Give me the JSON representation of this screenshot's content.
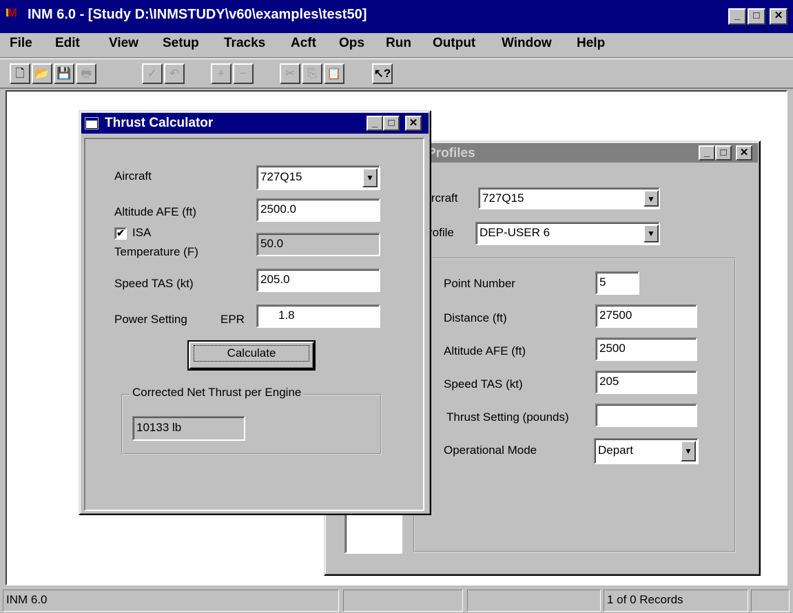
{
  "app": {
    "title": "INM 6.0 - [Study D:\\INMSTUDY\\v60\\examples\\test50]",
    "icon_text": "I",
    "icon_text_sub": "M",
    "caption_buttons": {
      "minimize": "_",
      "maximize": "□",
      "close": "✕"
    }
  },
  "menu": {
    "items": [
      "File",
      "Edit",
      "View",
      "Setup",
      "Tracks",
      "Acft",
      "Ops",
      "Run",
      "Output",
      "Window",
      "Help"
    ]
  },
  "toolbar": {
    "buttons": [
      {
        "name": "new-icon",
        "glyph": "🗋"
      },
      {
        "name": "open-icon",
        "glyph": "📂"
      },
      {
        "name": "save-icon",
        "glyph": "💾"
      },
      {
        "name": "print-icon",
        "glyph": "🖶"
      },
      {
        "name": "commit-icon",
        "glyph": "✓"
      },
      {
        "name": "undo-icon",
        "glyph": "↶"
      },
      {
        "name": "add-icon",
        "glyph": "+"
      },
      {
        "name": "remove-icon",
        "glyph": "−"
      },
      {
        "name": "cut-icon",
        "glyph": "✂"
      },
      {
        "name": "copy-icon",
        "glyph": "⎘"
      },
      {
        "name": "paste-icon",
        "glyph": "📋"
      },
      {
        "name": "context-help-icon",
        "glyph": "↖?"
      }
    ]
  },
  "thrust_calc": {
    "title": "Thrust Calculator",
    "aircraft_label": "Aircraft",
    "aircraft_value": "727Q15",
    "altitude_label": "Altitude AFE (ft)",
    "altitude_value": "2500.0",
    "isa_label": "ISA",
    "isa_checked": "✔",
    "temperature_label": "Temperature (F)",
    "temperature_value": "50.0",
    "speed_label": "Speed TAS (kt)",
    "speed_value": "205.0",
    "power_label": "Power Setting",
    "power_unit": "EPR",
    "power_value": "1.8",
    "calculate_button": "Calculate",
    "result_group_label": "Corrected Net Thrust per Engine",
    "result_value": "10133 lb"
  },
  "profiles": {
    "title": "Profiles",
    "aircraft_label": "ircraft",
    "aircraft_value": "727Q15",
    "profile_label": "rofile",
    "profile_value": "DEP-USER   6",
    "point_number_label": "Point Number",
    "point_number_value": "5",
    "distance_label": "Distance (ft)",
    "distance_value": "27500",
    "altitude_label": "Altitude AFE  (ft)",
    "altitude_value": "2500",
    "speed_label": "Speed  TAS  (kt)",
    "speed_value": "205",
    "thrust_label": "Thrust Setting (pounds)",
    "thrust_value": "",
    "mode_label": "Operational Mode",
    "mode_value": "Depart"
  },
  "status": {
    "app_name": "INM 6.0",
    "records": "1 of 0 Records"
  }
}
